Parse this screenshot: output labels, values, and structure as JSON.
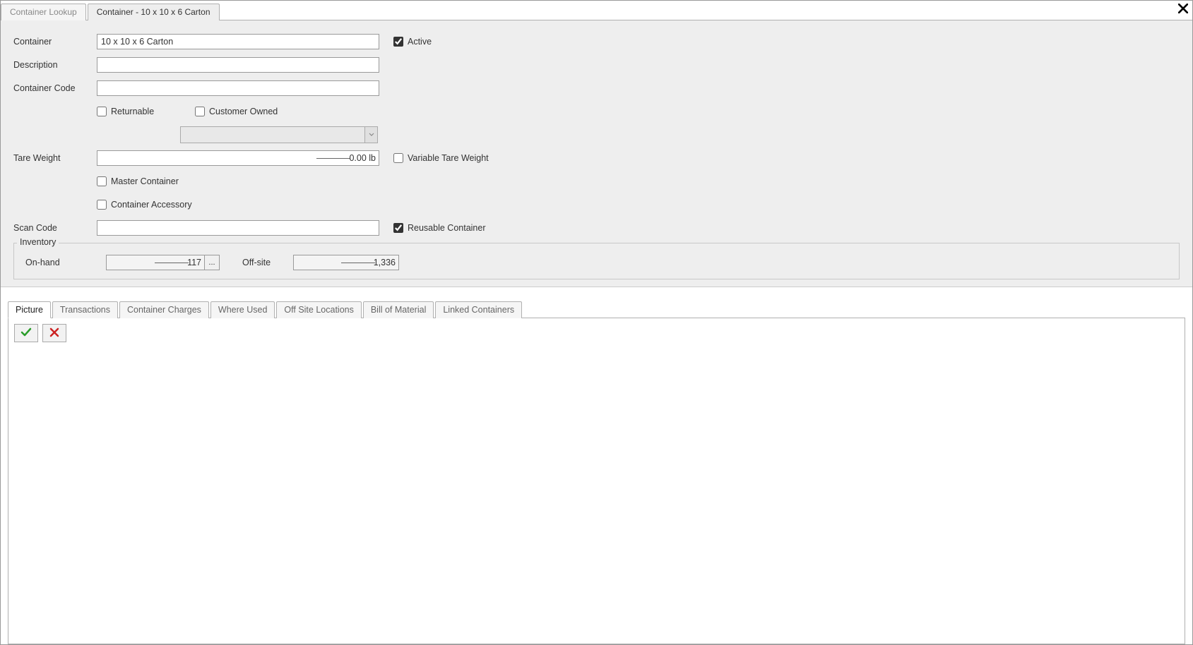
{
  "topTabs": {
    "lookup": "Container Lookup",
    "detail": "Container - 10 x 10 x 6 Carton"
  },
  "form": {
    "labels": {
      "container": "Container",
      "description": "Description",
      "containerCode": "Container Code",
      "tareWeight": "Tare Weight",
      "scanCode": "Scan Code"
    },
    "values": {
      "container": "10 x 10 x 6 Carton",
      "description": "",
      "containerCode": "",
      "tareWeight": "0.00 lb",
      "scanCode": ""
    },
    "checkboxes": {
      "active": "Active",
      "returnable": "Returnable",
      "customerOwned": "Customer Owned",
      "variableTareWeight": "Variable Tare Weight",
      "masterContainer": "Master Container",
      "containerAccessory": "Container Accessory",
      "reusableContainer": "Reusable Container"
    },
    "checkboxStates": {
      "active": true,
      "returnable": false,
      "customerOwned": false,
      "variableTareWeight": false,
      "masterContainer": false,
      "containerAccessory": false,
      "reusableContainer": true
    }
  },
  "inventory": {
    "legend": "Inventory",
    "onHandLabel": "On-hand",
    "onHandValue": "117",
    "lookupBtn": "...",
    "offSiteLabel": "Off-site",
    "offSiteValue": "1,336"
  },
  "subTabs": {
    "picture": "Picture",
    "transactions": "Transactions",
    "containerCharges": "Container Charges",
    "whereUsed": "Where Used",
    "offSiteLocations": "Off Site Locations",
    "billOfMaterial": "Bill of Material",
    "linkedContainers": "Linked Containers"
  }
}
